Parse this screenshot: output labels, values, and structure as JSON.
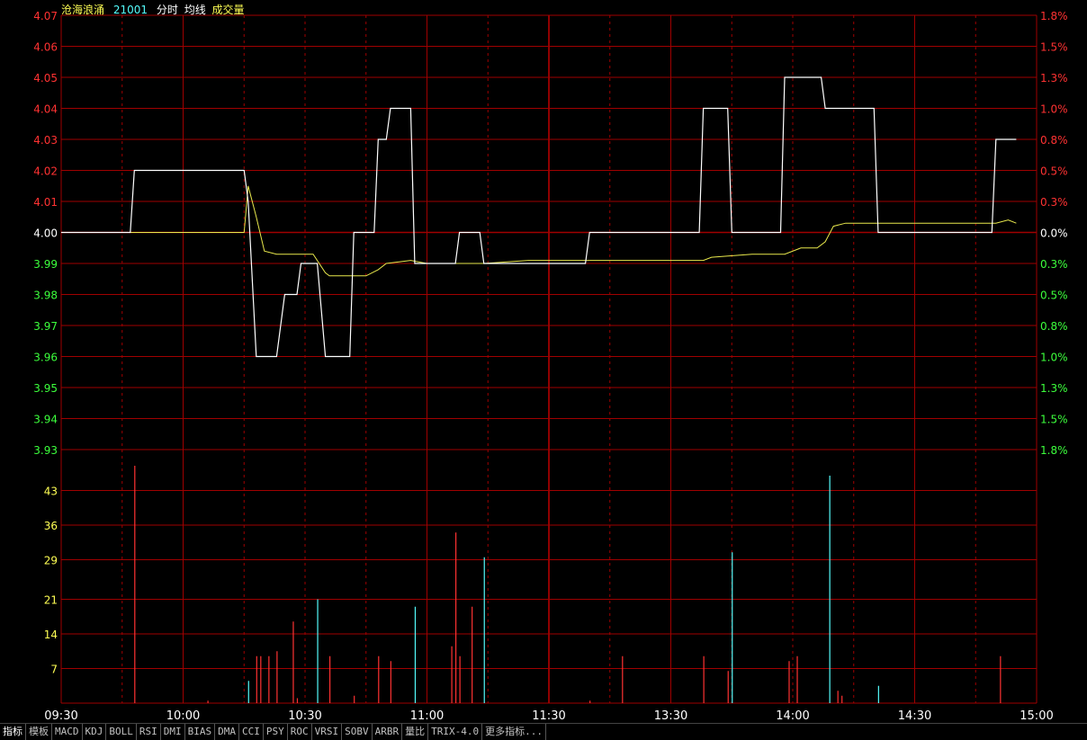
{
  "header": {
    "name": "沧海浪涌",
    "code": "21001",
    "labels": [
      "分时",
      "均线",
      "成交量"
    ]
  },
  "tabs": [
    "指标",
    "模板",
    "MACD",
    "KDJ",
    "BOLL",
    "RSI",
    "DMI",
    "BIAS",
    "DMA",
    "CCI",
    "PSY",
    "ROC",
    "VRSI",
    "SOBV",
    "ARBR",
    "量比",
    "TRIX-4.0",
    "更多指标..."
  ],
  "colors": {
    "grid": "#a00000",
    "up": "#ff3232",
    "down": "#54fcfc",
    "price_line": "#ffffff",
    "avg_line": "#e8e84c",
    "axis_up": "#ff3232",
    "axis_down": "#3cff3c",
    "axis_flat": "#ffffff",
    "vol_axis": "#ffff54",
    "time_axis": "#ffffff"
  },
  "chart_data": [
    {
      "type": "line",
      "title": "分时",
      "prev_close": 4.0,
      "ylim": [
        3.93,
        4.07
      ],
      "y_ticks_left": [
        "4.07",
        "4.06",
        "4.05",
        "4.04",
        "4.03",
        "4.02",
        "4.01",
        "4.00",
        "3.99",
        "3.98",
        "3.97",
        "3.96",
        "3.95",
        "3.94",
        "3.93"
      ],
      "y_ticks_right": [
        "1.8%",
        "1.5%",
        "1.3%",
        "1.0%",
        "0.8%",
        "0.5%",
        "0.3%",
        "0.0%",
        "0.3%",
        "0.5%",
        "0.8%",
        "1.0%",
        "1.3%",
        "1.5%",
        "1.8%"
      ],
      "x_ticks": [
        "09:30",
        "10:00",
        "10:30",
        "11:00",
        "11:30",
        "13:30",
        "14:00",
        "14:30",
        "15:00"
      ],
      "series": [
        {
          "name": "分时",
          "points": [
            [
              0,
              4.0
            ],
            [
              17,
              4.0
            ],
            [
              18,
              4.02
            ],
            [
              45,
              4.02
            ],
            [
              46,
              4.01
            ],
            [
              48,
              3.96
            ],
            [
              53,
              3.96
            ],
            [
              55,
              3.98
            ],
            [
              58,
              3.98
            ],
            [
              59,
              3.99
            ],
            [
              63,
              3.99
            ],
            [
              65,
              3.96
            ],
            [
              71,
              3.96
            ],
            [
              72,
              4.0
            ],
            [
              77,
              4.0
            ],
            [
              78,
              4.03
            ],
            [
              80,
              4.03
            ],
            [
              81,
              4.04
            ],
            [
              86,
              4.04
            ],
            [
              87,
              3.99
            ],
            [
              97,
              3.99
            ],
            [
              98,
              4.0
            ],
            [
              103,
              4.0
            ],
            [
              104,
              3.99
            ],
            [
              129,
              3.99
            ],
            [
              130,
              4.0
            ],
            [
              157,
              4.0
            ],
            [
              158,
              4.04
            ],
            [
              164,
              4.04
            ],
            [
              165,
              4.0
            ],
            [
              177,
              4.0
            ],
            [
              178,
              4.05
            ],
            [
              187,
              4.05
            ],
            [
              188,
              4.04
            ],
            [
              200,
              4.04
            ],
            [
              201,
              4.0
            ],
            [
              229,
              4.0
            ],
            [
              230,
              4.03
            ],
            [
              235,
              4.03
            ]
          ]
        },
        {
          "name": "均线",
          "points": [
            [
              0,
              4.0
            ],
            [
              45,
              4.0
            ],
            [
              46,
              4.015
            ],
            [
              48,
              4.005
            ],
            [
              50,
              3.994
            ],
            [
              53,
              3.993
            ],
            [
              58,
              3.993
            ],
            [
              62,
              3.993
            ],
            [
              65,
              3.987
            ],
            [
              66,
              3.986
            ],
            [
              70,
              3.986
            ],
            [
              75,
              3.986
            ],
            [
              78,
              3.988
            ],
            [
              80,
              3.99
            ],
            [
              86,
              3.991
            ],
            [
              90,
              3.99
            ],
            [
              100,
              3.99
            ],
            [
              104,
              3.99
            ],
            [
              115,
              3.991
            ],
            [
              130,
              3.991
            ],
            [
              150,
              3.991
            ],
            [
              158,
              3.991
            ],
            [
              160,
              3.992
            ],
            [
              170,
              3.993
            ],
            [
              178,
              3.993
            ],
            [
              182,
              3.995
            ],
            [
              186,
              3.995
            ],
            [
              188,
              3.997
            ],
            [
              190,
              4.002
            ],
            [
              193,
              4.003
            ],
            [
              210,
              4.003
            ],
            [
              220,
              4.003
            ],
            [
              230,
              4.003
            ],
            [
              233,
              4.004
            ],
            [
              235,
              4.003
            ]
          ]
        }
      ]
    },
    {
      "type": "bar",
      "title": "成交量",
      "ylim": [
        0,
        46
      ],
      "y_ticks": [
        "43",
        "36",
        "29",
        "21",
        "14",
        "7"
      ],
      "bars": [
        {
          "x": 18,
          "v": 48,
          "dir": "up"
        },
        {
          "x": 36,
          "v": 0.5,
          "dir": "up"
        },
        {
          "x": 46,
          "v": 4.5,
          "dir": "down"
        },
        {
          "x": 48,
          "v": 9.5,
          "dir": "up"
        },
        {
          "x": 49,
          "v": 9.5,
          "dir": "up"
        },
        {
          "x": 51,
          "v": 9.5,
          "dir": "up"
        },
        {
          "x": 53,
          "v": 10.5,
          "dir": "up"
        },
        {
          "x": 57,
          "v": 16.5,
          "dir": "up"
        },
        {
          "x": 58,
          "v": 1,
          "dir": "up"
        },
        {
          "x": 63,
          "v": 21,
          "dir": "down"
        },
        {
          "x": 66,
          "v": 9.5,
          "dir": "up"
        },
        {
          "x": 72,
          "v": 1.5,
          "dir": "up"
        },
        {
          "x": 78,
          "v": 9.5,
          "dir": "up"
        },
        {
          "x": 81,
          "v": 8.5,
          "dir": "up"
        },
        {
          "x": 87,
          "v": 19.5,
          "dir": "down"
        },
        {
          "x": 96,
          "v": 11.5,
          "dir": "up"
        },
        {
          "x": 97,
          "v": 34.5,
          "dir": "up"
        },
        {
          "x": 98,
          "v": 9.5,
          "dir": "up"
        },
        {
          "x": 101,
          "v": 19.5,
          "dir": "up"
        },
        {
          "x": 104,
          "v": 29.5,
          "dir": "down"
        },
        {
          "x": 130,
          "v": 0.5,
          "dir": "up"
        },
        {
          "x": 138,
          "v": 9.5,
          "dir": "up"
        },
        {
          "x": 158,
          "v": 9.5,
          "dir": "up"
        },
        {
          "x": 164,
          "v": 6.5,
          "dir": "up"
        },
        {
          "x": 165,
          "v": 30.5,
          "dir": "down"
        },
        {
          "x": 179,
          "v": 8.5,
          "dir": "up"
        },
        {
          "x": 181,
          "v": 9.5,
          "dir": "up"
        },
        {
          "x": 189,
          "v": 46,
          "dir": "down"
        },
        {
          "x": 191,
          "v": 2.5,
          "dir": "up"
        },
        {
          "x": 192,
          "v": 1.5,
          "dir": "up"
        },
        {
          "x": 201,
          "v": 3.5,
          "dir": "down"
        },
        {
          "x": 231,
          "v": 9.5,
          "dir": "up"
        }
      ]
    }
  ]
}
